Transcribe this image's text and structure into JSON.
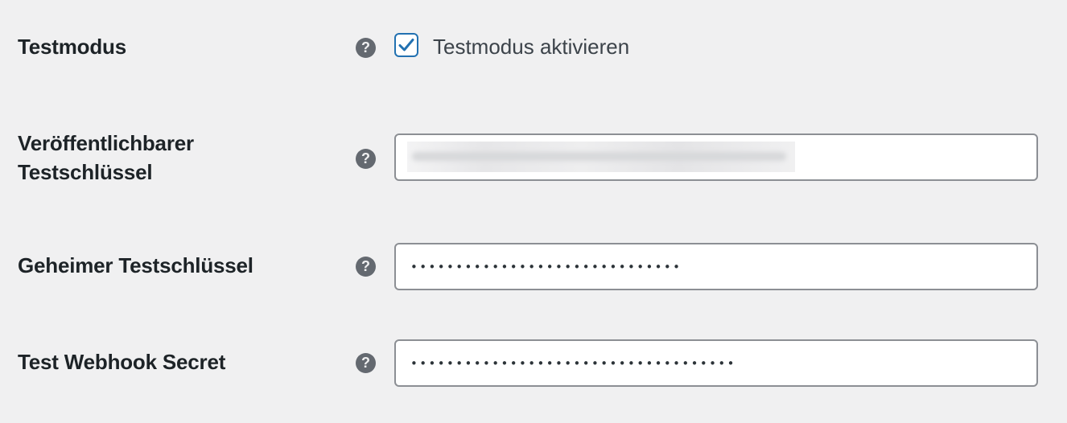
{
  "colors": {
    "background": "#f0f0f1",
    "accent": "#2271b1",
    "input_border": "#8c8f94",
    "help_icon": "#646970"
  },
  "settings": {
    "test_mode": {
      "label": "Testmodus",
      "help_icon": "question-mark-icon",
      "checkbox_checked": true,
      "checkbox_label": "Testmodus aktivieren"
    },
    "publishable_test_key": {
      "label_line1": "Veröffentlichbarer",
      "label_line2": "Testschlüssel",
      "help_icon": "question-mark-icon"
    },
    "secret_test_key": {
      "label": "Geheimer Testschlüssel",
      "help_icon": "question-mark-icon",
      "masked_value": "••••••••••••••••••••••••••••••"
    },
    "test_webhook_secret": {
      "label": "Test Webhook Secret",
      "help_icon": "question-mark-icon",
      "masked_value": "••••••••••••••••••••••••••••••••••••"
    }
  }
}
